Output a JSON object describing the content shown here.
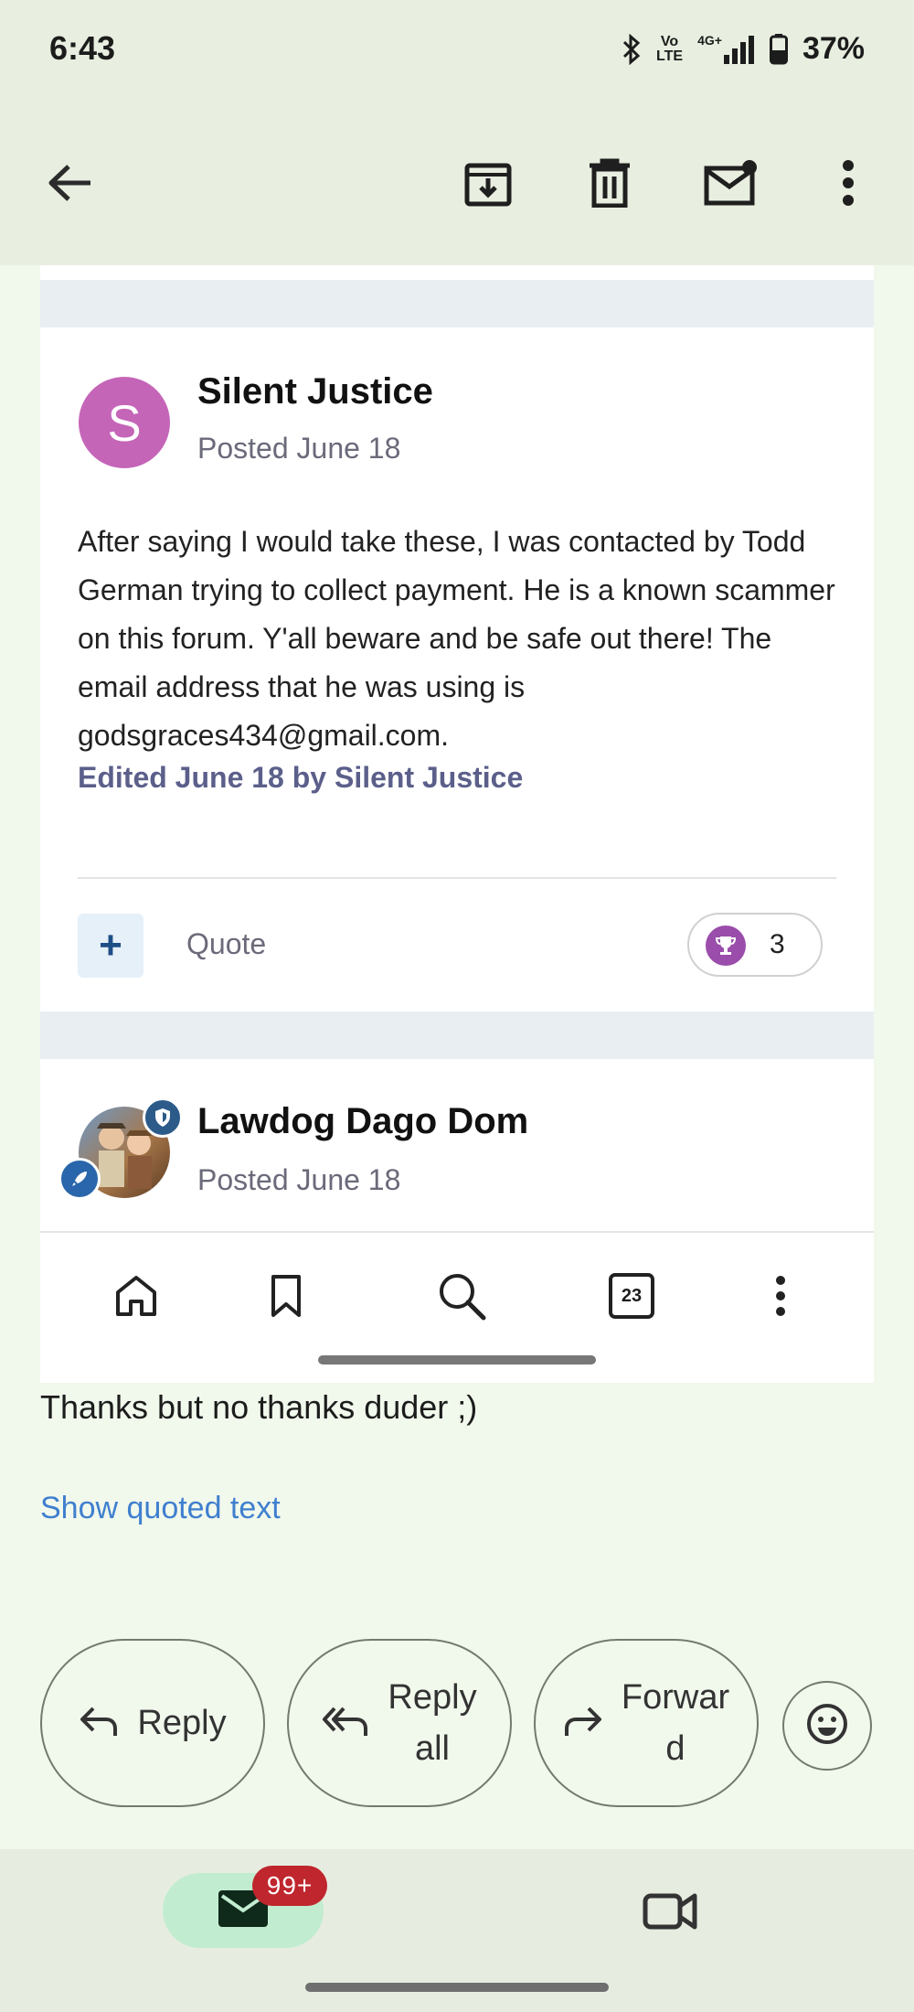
{
  "status_bar": {
    "time": "6:43",
    "volte_line1": "Vo",
    "volte_line2": "LTE",
    "network": "4G+",
    "battery": "37%"
  },
  "toolbar": {
    "icons": [
      "back-arrow-icon",
      "archive-icon",
      "delete-icon",
      "mark-unread-icon",
      "more-vert-icon"
    ]
  },
  "post1": {
    "avatar_letter": "S",
    "author": "Silent Justice",
    "posted": "Posted June 18",
    "body": "After saying I would take these, I was contacted by Todd German trying to collect payment. He is a known scammer on this forum. Y'all beware and be safe out there! The email address that he was using is godsgraces434@gmail.com.",
    "edited": "Edited June 18 by Silent Justice",
    "plus": "+",
    "quote_label": "Quote",
    "reaction_count": "3"
  },
  "post2": {
    "author": "Lawdog Dago Dom",
    "posted": "Posted June 18"
  },
  "browser_nav": {
    "tabs_count": "23",
    "icons": [
      "home-icon",
      "bookmark-icon",
      "search-icon",
      "tabs-icon",
      "more-vert-icon"
    ]
  },
  "email": {
    "reply_text": "Thanks but no thanks duder ;)",
    "show_quoted": "Show quoted text"
  },
  "actions": {
    "reply": "Reply",
    "reply_all_line1": "Reply",
    "reply_all_line2": "all",
    "forward_line1": "Forwar",
    "forward_line2": "d"
  },
  "bottom_nav": {
    "mail_badge": "99+"
  }
}
